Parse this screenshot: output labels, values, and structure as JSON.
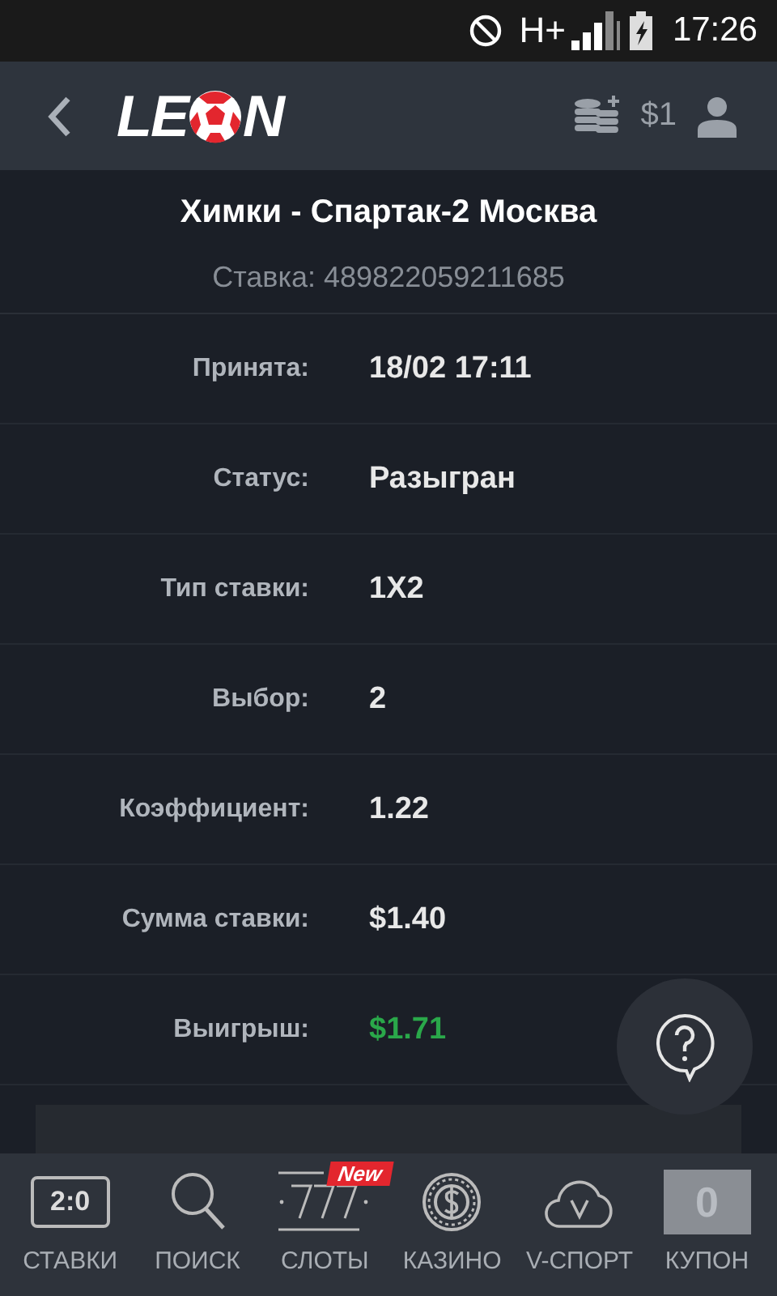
{
  "status_bar": {
    "network": "H+",
    "time": "17:26"
  },
  "header": {
    "logo": {
      "before": "LE",
      "after": "N"
    },
    "balance": "$1"
  },
  "bet": {
    "title": "Химки - Спартак-2 Москва",
    "number": "Ставка: 489822059211685",
    "rows": [
      {
        "label": "Принята:",
        "value": "18/02 17:11",
        "kind": "plain"
      },
      {
        "label": "Статус:",
        "value": "Разыгран",
        "kind": "plain"
      },
      {
        "label": "Тип ставки:",
        "value": "1X2",
        "kind": "plain"
      },
      {
        "label": "Выбор:",
        "value": "2",
        "kind": "plain"
      },
      {
        "label": "Коэффициент:",
        "value": "1.22",
        "kind": "plain"
      },
      {
        "label": "Сумма ставки:",
        "value": "$1.40",
        "kind": "plain"
      },
      {
        "label": "Выигрыш:",
        "value": "$1.71",
        "kind": "win"
      }
    ]
  },
  "bottom_nav": [
    {
      "kind": "score",
      "label": "СТАВКИ",
      "icon_text": "2:0"
    },
    {
      "kind": "search",
      "label": "ПОИСК"
    },
    {
      "kind": "slots",
      "label": "СЛОТЫ",
      "badge": "New"
    },
    {
      "kind": "casino",
      "label": "КАЗИНО"
    },
    {
      "kind": "vsport",
      "label": "V-СПОРТ"
    },
    {
      "kind": "coupon",
      "label": "КУПОН",
      "icon_text": "0"
    }
  ]
}
